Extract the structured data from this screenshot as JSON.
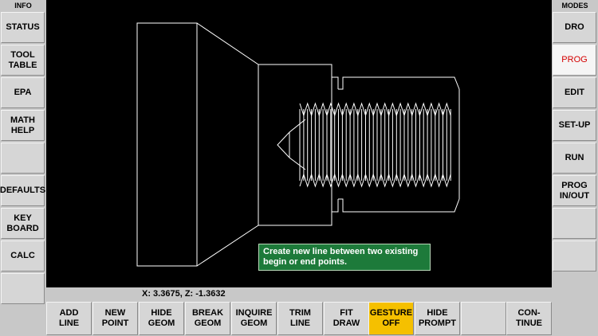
{
  "left_panel": {
    "header": "INFO",
    "buttons": [
      {
        "label": "STATUS",
        "active": false
      },
      {
        "label": "TOOL\nTABLE",
        "active": false
      },
      {
        "label": "EPA",
        "active": false
      },
      {
        "label": "MATH\nHELP",
        "active": false
      },
      {
        "label": "",
        "active": false
      },
      {
        "label": "DEFAULTS",
        "active": false
      },
      {
        "label": "KEY\nBOARD",
        "active": false
      },
      {
        "label": "CALC",
        "active": false
      },
      {
        "label": "",
        "active": false
      }
    ]
  },
  "right_panel": {
    "header": "MODES",
    "buttons": [
      {
        "label": "DRO",
        "active": false
      },
      {
        "label": "PROG",
        "active": true
      },
      {
        "label": "EDIT",
        "active": false
      },
      {
        "label": "SET-UP",
        "active": false
      },
      {
        "label": "RUN",
        "active": false
      },
      {
        "label": "PROG\nIN/OUT",
        "active": false
      },
      {
        "label": "",
        "active": false
      },
      {
        "label": "",
        "active": false
      }
    ]
  },
  "prompt": {
    "text": "Create new line between two existing begin or end points."
  },
  "coordinates": {
    "text": "X: 3.3675, Z: -1.3632"
  },
  "bottom_bar": {
    "buttons": [
      {
        "label": "ADD\nLINE",
        "highlight": false
      },
      {
        "label": "NEW\nPOINT",
        "highlight": false
      },
      {
        "label": "HIDE\nGEOM",
        "highlight": false
      },
      {
        "label": "BREAK\nGEOM",
        "highlight": false
      },
      {
        "label": "INQUIRE\nGEOM",
        "highlight": false
      },
      {
        "label": "TRIM\nLINE",
        "highlight": false
      },
      {
        "label": "FIT\nDRAW",
        "highlight": false
      },
      {
        "label": "GESTURE\nOFF",
        "highlight": true
      },
      {
        "label": "HIDE\nPROMPT",
        "highlight": false
      },
      {
        "label": "",
        "highlight": false
      },
      {
        "label": "CON-\nTINUE",
        "highlight": false
      }
    ]
  },
  "colors": {
    "highlight": "#f5c000",
    "active_text": "#d40000",
    "prompt_bg": "#1d7a3a",
    "drawing_bg": "#000000",
    "geometry": "#ffffff"
  }
}
